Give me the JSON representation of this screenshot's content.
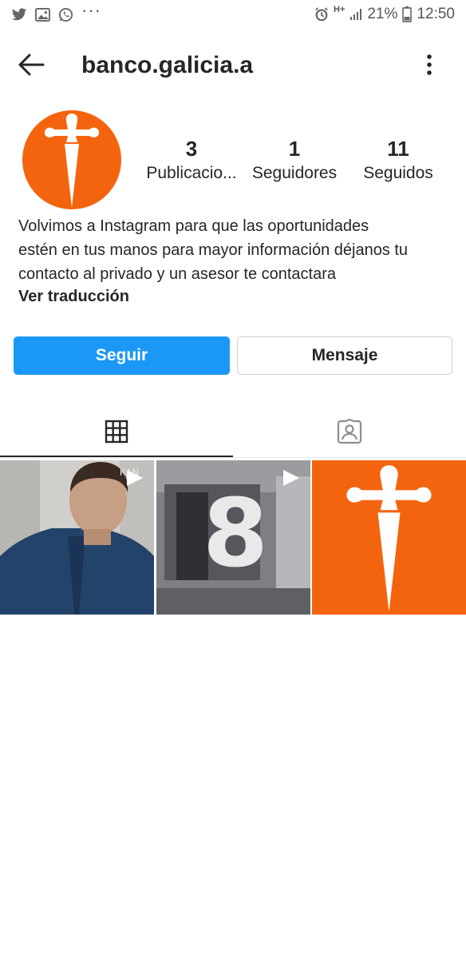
{
  "status_bar": {
    "battery_percent": "21%",
    "time": "12:50",
    "network": "H+",
    "left_icons": [
      "twitter-icon",
      "gallery-icon",
      "whatsapp-icon",
      "more-dots-icon"
    ],
    "right_icons": [
      "alarm-icon",
      "network-icon",
      "signal-icon",
      "battery-icon"
    ]
  },
  "header": {
    "username": "banco.galicia.a"
  },
  "profile": {
    "brand_color": "#f4640f",
    "stats": [
      {
        "value": "3",
        "label": "Publicacio..."
      },
      {
        "value": "1",
        "label": "Seguidores"
      },
      {
        "value": "11",
        "label": "Seguidos"
      }
    ],
    "bio_lines": [
      "Volvimos a Instagram para que las oportunidades",
      "estén en tus manos para mayor información déjanos tu",
      "contacto al privado y un asesor te contactara"
    ],
    "translate_label": "Ver traducción"
  },
  "actions": {
    "follow_label": "Seguir",
    "message_label": "Mensaje",
    "follow_color": "#1b98f5"
  },
  "tabs": [
    {
      "icon": "grid-icon",
      "active": true
    },
    {
      "icon": "tagged-person-icon",
      "active": false
    }
  ],
  "posts": [
    {
      "type": "video",
      "overlay_text": "KIN"
    },
    {
      "type": "video",
      "overlay_text": "8"
    },
    {
      "type": "image"
    }
  ]
}
